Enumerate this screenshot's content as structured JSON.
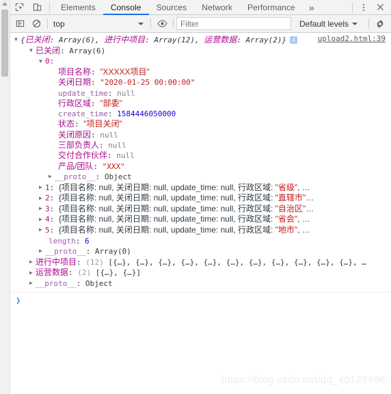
{
  "devtools": {
    "tabs": [
      {
        "label": "Elements",
        "active": false
      },
      {
        "label": "Console",
        "active": true
      },
      {
        "label": "Sources",
        "active": false
      },
      {
        "label": "Network",
        "active": false
      },
      {
        "label": "Performance",
        "active": false
      }
    ],
    "more_tabs_label": "»",
    "inspect_icon": "inspect-element-icon",
    "device_icon": "device-toolbar-icon",
    "menu_icon": "more-options-icon",
    "close_icon": "close-icon"
  },
  "toolbar": {
    "sidebar_icon": "console-sidebar-icon",
    "clear_icon": "clear-console-icon",
    "context_value": "top",
    "eye_icon": "live-expression-icon",
    "filter_placeholder": "Filter",
    "filter_value": "",
    "levels_label": "Default levels",
    "settings_icon": "settings-gear-icon"
  },
  "console": {
    "source_link": "upload2.html:39",
    "summary": {
      "open_brace": "{",
      "close_brace": "}",
      "parts": [
        {
          "key": "已关闭",
          "value": "Array(6)"
        },
        {
          "key": "进行中项目",
          "value": "Array(12)"
        },
        {
          "key": "运营数据",
          "value": "Array(2)"
        }
      ],
      "info_badge": "i"
    },
    "closed_array": {
      "key": "已关闭",
      "value": "Array(6)",
      "index_0_label": "0:",
      "item0_props": [
        {
          "key": "项目名称",
          "value": "\"XXXXX项目\"",
          "type": "string"
        },
        {
          "key": "关闭日期",
          "value": "\"2020-01-25 00:00:00\"",
          "type": "string"
        },
        {
          "key": "update_time",
          "value": "null",
          "type": "null"
        },
        {
          "key": "行政区域",
          "value": "\"部委\"",
          "type": "string"
        },
        {
          "key": "create_time",
          "value": "1584446050000",
          "type": "number"
        },
        {
          "key": "状态",
          "value": "\"项目关闭\"",
          "type": "string"
        },
        {
          "key": "关闭原因",
          "value": "null",
          "type": "null"
        },
        {
          "key": "三部负责人",
          "value": "null",
          "type": "null"
        },
        {
          "key": "交付合作伙伴",
          "value": "null",
          "type": "null"
        },
        {
          "key": "产品/团队",
          "value": "\"XXX\"",
          "type": "string"
        }
      ],
      "item0_proto": {
        "key": "__proto__",
        "value": "Object"
      },
      "collapsed_items": [
        {
          "index": "1",
          "region": "\"省级\"",
          "tail": ", …"
        },
        {
          "index": "2",
          "region": "\"直辖市\"",
          "tail": "…"
        },
        {
          "index": "3",
          "region": "\"自治区\"",
          "tail": "…"
        },
        {
          "index": "4",
          "region": "\"省会\"",
          "tail": ", …"
        },
        {
          "index": "5",
          "region": "\"地市\"",
          "tail": ", …"
        }
      ],
      "collapsed_prefix": "{项目名称: null, 关闭日期: null, update_time: null, 行政区域: ",
      "length_key": "length",
      "length_value": "6",
      "proto_key": "__proto__",
      "proto_value": "Array(0)"
    },
    "other_entries": [
      {
        "key": "进行中项目",
        "count": "(12)",
        "preview": "[{…}, {…}, {…}, {…}, {…}, {…}, {…}, {…}, {…}, {…}, {…}, …"
      },
      {
        "key": "运营数据",
        "count": "(2)",
        "preview": "[{…}, {…}]"
      }
    ],
    "root_proto": {
      "key": "__proto__",
      "value": "Object"
    },
    "prompt_symbol": "❯"
  },
  "watermark": "https://blog.csdn.net/qq_40126996",
  "colors": {
    "accent": "#1a73e8",
    "key": "#aa0d91",
    "string": "#c41a16",
    "number": "#1c00cf",
    "null": "#808080",
    "chrome_bg": "#f3f3f3"
  }
}
